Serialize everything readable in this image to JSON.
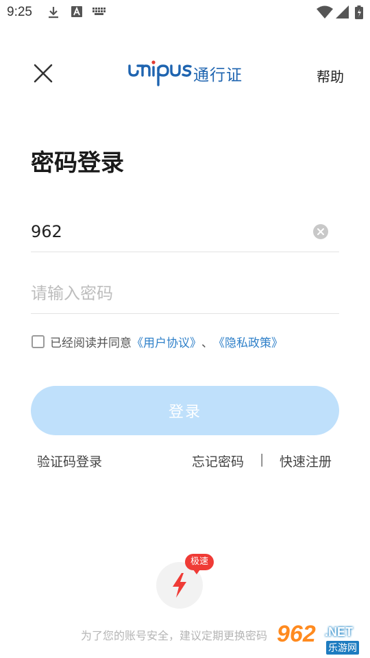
{
  "status_bar": {
    "time": "9:25",
    "icons": [
      "download-icon",
      "font-a-icon",
      "keyboard-icon",
      "wifi-icon",
      "cell-signal-icon",
      "battery-icon"
    ]
  },
  "header": {
    "brand_text": "unipus",
    "brand_cn": "通行证",
    "help_label": "帮助",
    "brand_color": "#1e64b0"
  },
  "page": {
    "title": "密码登录"
  },
  "form": {
    "account_value": "962",
    "password_placeholder": "请输入密码",
    "agreement_prefix": "已经阅读并同意",
    "user_agreement": "《用户协议》",
    "separator": "、",
    "privacy_policy": "《隐私政策》",
    "login_label": "登录",
    "agreed": false
  },
  "links": {
    "sms_login": "验证码登录",
    "forgot_password": "忘记密码",
    "divider": "|",
    "quick_register": "快速注册"
  },
  "quick_login": {
    "badge": "极速",
    "icon": "lightning-icon"
  },
  "footer": {
    "security_tip": "为了您的账号安全，建议定期更换密码"
  },
  "watermark": {
    "number": "962",
    "net": ".NET",
    "site": "乐游网"
  },
  "colors": {
    "accent": "#2f80c9",
    "button_disabled": "#bfe0fb",
    "badge": "#ef3b36",
    "lightning": "#ef3b36"
  }
}
